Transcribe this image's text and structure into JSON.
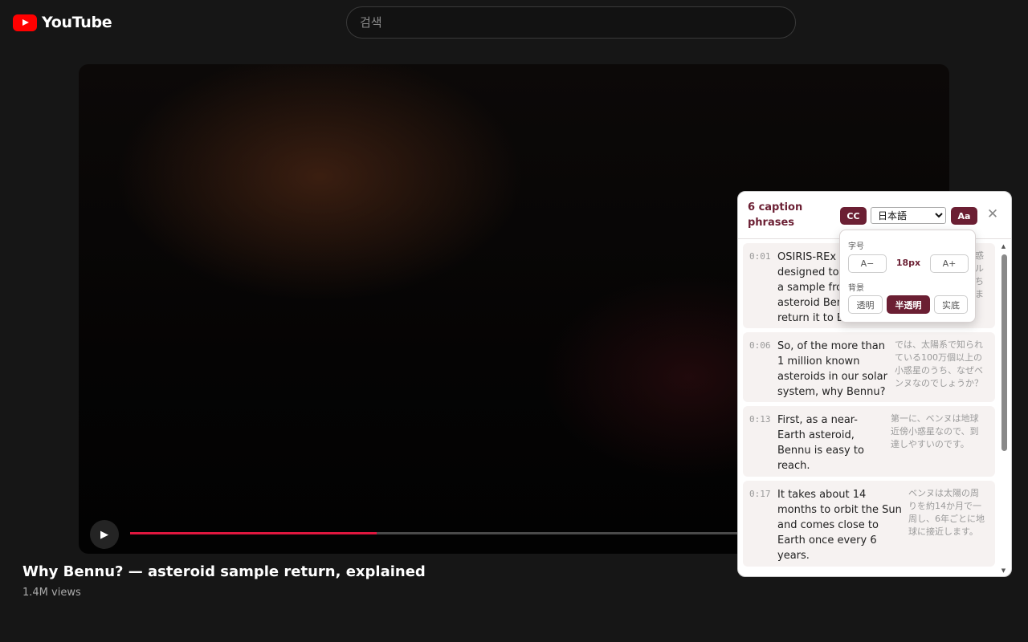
{
  "header": {
    "logo_text": "YouTube",
    "search_placeholder": "검색"
  },
  "player": {
    "play_icon": "▶",
    "progress_fraction": 0.307
  },
  "video": {
    "title": "Why Bennu? — asteroid sample return, explained",
    "views": "1.4M views"
  },
  "caption_panel": {
    "title": "6 caption phrases",
    "cc_label": "CC",
    "language_options": [
      "日本語"
    ],
    "language_selected": "日本語",
    "aa_label": "Aa",
    "close_icon": "✕",
    "captions": [
      {
        "time": "0:01",
        "en": [
          "OSIRIS-REx",
          "designed to",
          "a sample fro",
          "asteroid Ben",
          "return it to E"
        ],
        "ja": [
          "",
          "",
          "",
          ""
        ]
      },
      {
        "time": "0:06",
        "en": [
          "So, of the more than",
          "1 million known",
          "asteroids in our solar",
          "system, why Bennu?"
        ],
        "ja": [
          "では、太陽系で知られ",
          "ている100万個以上の",
          "小惑星のうち、なぜベ",
          "ンヌなのでしょうか？"
        ]
      },
      {
        "time": "0:13",
        "en": [
          "First, as a near-",
          "Earth asteroid,",
          "Bennu is easy to",
          "reach."
        ],
        "ja": [
          "第一に、ベンヌは地球",
          "近傍小惑星なので、到",
          "達しやすいのです。"
        ]
      },
      {
        "time": "0:17",
        "en": [
          "It takes about 14",
          "months to orbit the Sun",
          "and comes close to",
          "Earth once every 6",
          "years."
        ],
        "ja": [
          "ベンヌは太陽の周",
          "りを約14か月で一",
          "周し、6年ごとに地",
          "球に接近します。"
        ]
      }
    ],
    "first_caption_ja_fragments": [
      "惑",
      "ル",
      "ち",
      "ま"
    ]
  },
  "style_popover": {
    "size_label": "字号",
    "decrease_label": "A−",
    "size_value": "18px",
    "increase_label": "A+",
    "bg_label": "背景",
    "bg_options": [
      "透明",
      "半透明",
      "实底"
    ],
    "bg_selected": "半透明"
  },
  "colors": {
    "accent": "#6b1f33",
    "progress": "#e0173f",
    "youtube_red": "#ff0000"
  }
}
